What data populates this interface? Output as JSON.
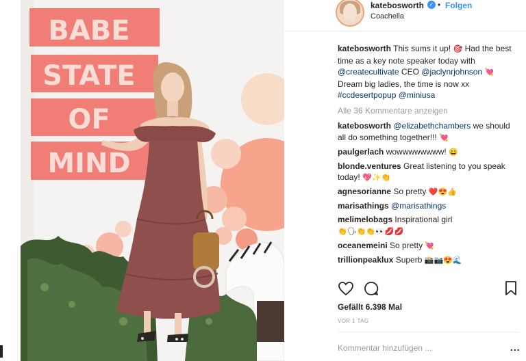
{
  "post": {
    "wall_text": [
      "BABE",
      "STATE",
      "OF",
      "MIND"
    ]
  },
  "header": {
    "username": "katebosworth",
    "dot": "•",
    "follow_label": "Folgen",
    "location": "Coachella"
  },
  "caption": {
    "user": "katebosworth",
    "text_1": "This sums it up!",
    "text_2": "Had the best time as a key note speaker today with",
    "mention_1": "@createcultivate",
    "text_3": "CEO",
    "mention_2": "@jaclynrjohnson",
    "text_4": "Dream big ladies, the time is now xx",
    "hashtag": "#ccdesertpopup",
    "mention_3": "@miniusa"
  },
  "view_all_comments": "Alle 36 Kommentare anzeigen",
  "comments": [
    {
      "user": "katebosworth",
      "mention": "@elizabethchambers",
      "text": "we should all do something together!!!",
      "emoji": "💘"
    },
    {
      "user": "paulgerlach",
      "text": "wowwwwwwww!",
      "emoji": "😄"
    },
    {
      "user": "blonde.ventures",
      "text": "Great listening to you speak today!",
      "emoji": "💖✨👏"
    },
    {
      "user": "agnesorianne",
      "text": "So pretty",
      "emoji": "❤️😍👍"
    },
    {
      "user": "marisathings",
      "mention": "@marisathings"
    },
    {
      "user": "melimelobags",
      "text": "Inspirational girl",
      "emoji": "👏🗣👏👏👀💋💋"
    },
    {
      "user": "oceanemeini",
      "text": "So pretty",
      "emoji": "💘"
    },
    {
      "user": "trillionpeaklux",
      "text": "Superb",
      "emoji": "📸📷😍🌊"
    }
  ],
  "likes": "Gefällt 6.398 Mal",
  "time_ago": "VOR 1 TAG",
  "add_comment_placeholder": "Kommentar hinzufügen ...",
  "more_label": "...",
  "icons": {
    "verified": "verified-badge-icon",
    "like": "heart-icon",
    "comment": "speech-bubble-icon",
    "save": "bookmark-icon"
  },
  "colors": {
    "link_blue": "#3897f0",
    "mention_blue": "#003569",
    "muted_gray": "#999999",
    "wall_sign_red": "#f07e77"
  }
}
